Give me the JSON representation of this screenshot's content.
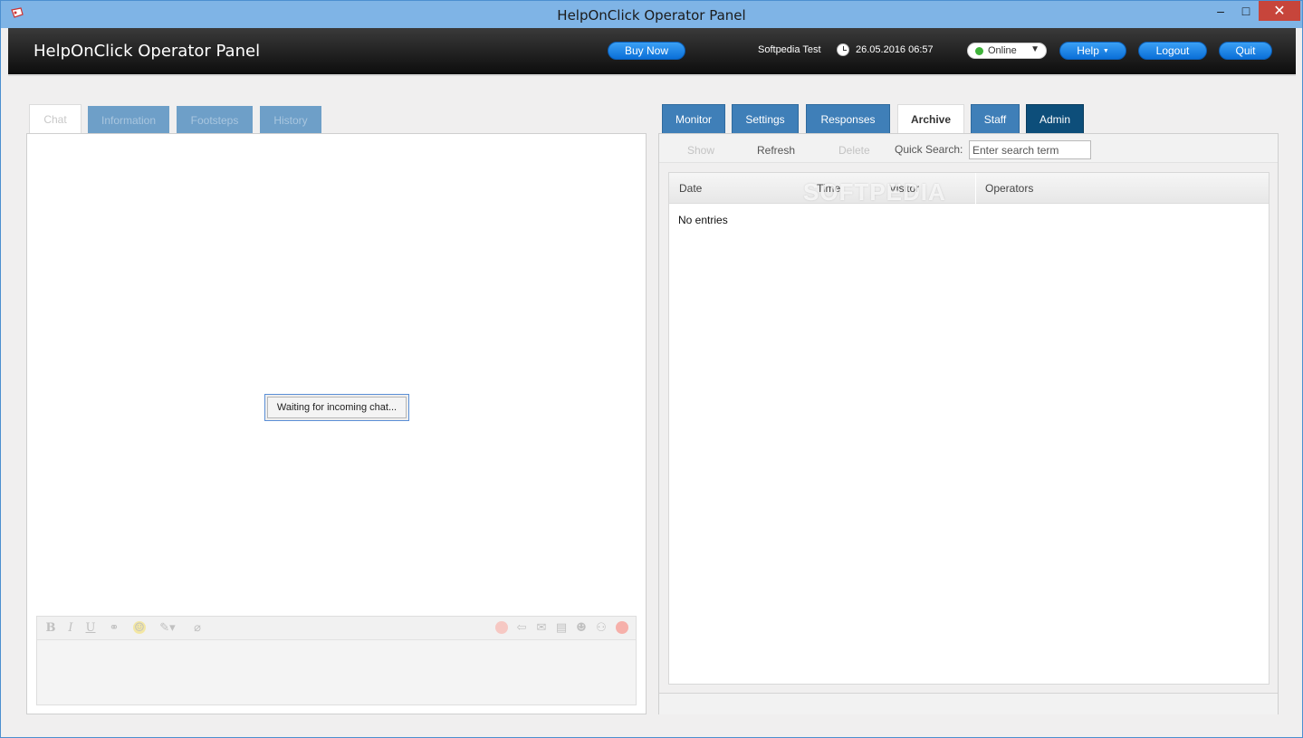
{
  "window": {
    "title": "HelpOnClick Operator Panel",
    "minimize": "‒",
    "maximize": "□",
    "close": "✕"
  },
  "header": {
    "app_title": "HelpOnClick Operator Panel",
    "buy_now": "Buy Now",
    "user": "Softpedia Test",
    "datetime": "26.05.2016 06:57",
    "status": "Online",
    "help": "Help",
    "logout": "Logout",
    "quit": "Quit"
  },
  "left_tabs": [
    "Chat",
    "Information",
    "Footsteps",
    "History"
  ],
  "chat": {
    "waiting": "Waiting for incoming chat..."
  },
  "editor_toolbar": {
    "bold": "B",
    "italic": "I",
    "underline": "U"
  },
  "right_tabs": [
    "Monitor",
    "Settings",
    "Responses",
    "Archive",
    "Staff",
    "Admin"
  ],
  "archive": {
    "show": "Show",
    "refresh": "Refresh",
    "delete": "Delete",
    "quick_search_label": "Quick Search:",
    "search_placeholder": "Enter search term",
    "columns": [
      "Date",
      "Time",
      "Visitor",
      "Operators"
    ],
    "empty": "No entries",
    "watermark": "SOFTPEDIA"
  },
  "colors": {
    "accent": "#0a6fd8",
    "tab_blue": "#3f7fb8",
    "admin_tab": "#0d4e7a",
    "status_online": "#3fb23a"
  }
}
